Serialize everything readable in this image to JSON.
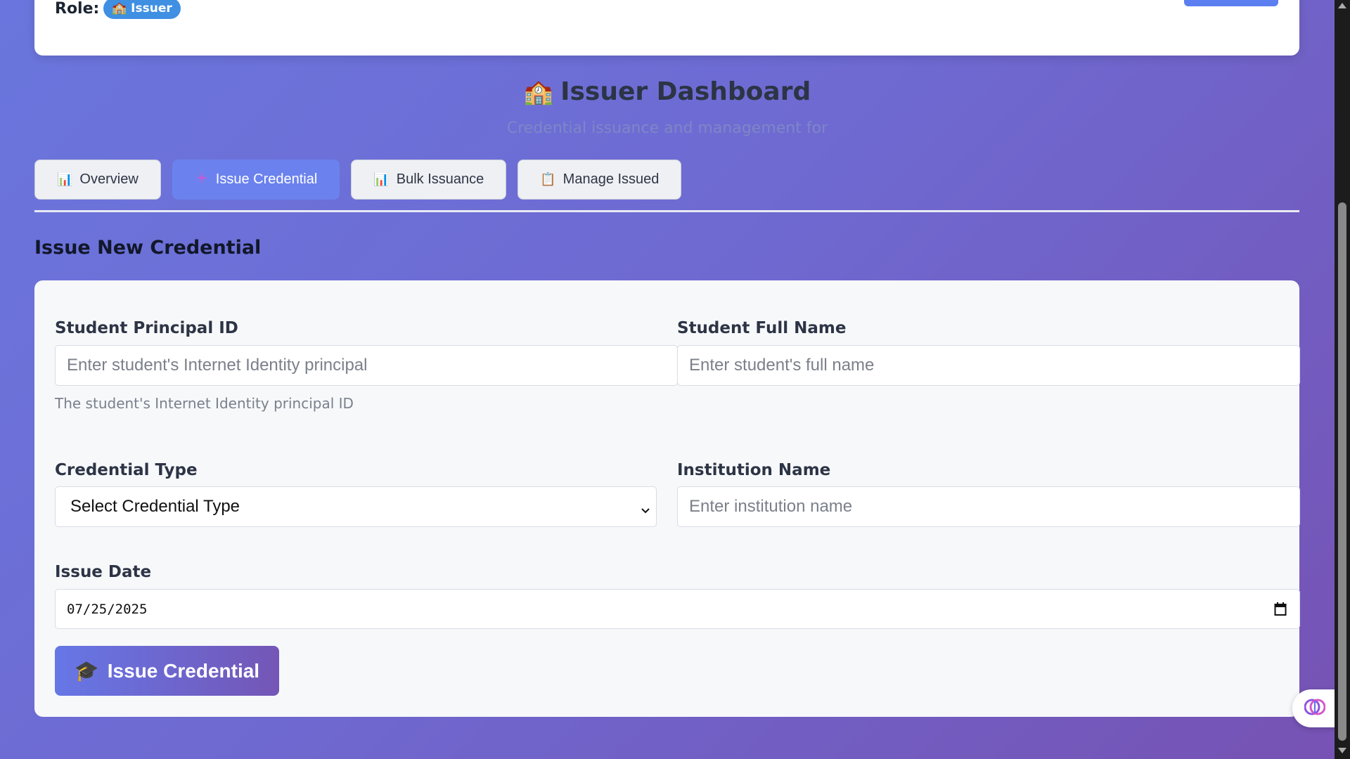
{
  "header": {
    "role_label": "Role:",
    "role_badge_icon": "🏫",
    "role_badge_text": "Issuer"
  },
  "dashboard": {
    "title_icon": "🏫",
    "title": "Issuer Dashboard",
    "subtitle": "Credential issuance and management for"
  },
  "tabs": [
    {
      "icon": "📊",
      "label": "Overview",
      "active": false
    },
    {
      "icon": "+",
      "label": "Issue Credential",
      "active": true
    },
    {
      "icon": "📊",
      "label": "Bulk Issuance",
      "active": false
    },
    {
      "icon": "📋",
      "label": "Manage Issued",
      "active": false
    }
  ],
  "section_title": "Issue New Credential",
  "form": {
    "student_principal": {
      "label": "Student Principal ID",
      "placeholder": "Enter student's Internet Identity principal",
      "hint": "The student's Internet Identity principal ID"
    },
    "student_name": {
      "label": "Student Full Name",
      "placeholder": "Enter student's full name"
    },
    "credential_type": {
      "label": "Credential Type",
      "selected": "Select Credential Type"
    },
    "institution": {
      "label": "Institution Name",
      "placeholder": "Enter institution name"
    },
    "issue_date": {
      "label": "Issue Date",
      "value": "07/25/2025"
    },
    "submit": {
      "icon": "🎓",
      "label": "Issue Credential"
    }
  },
  "colors": {
    "active_tab": "#6b82ee",
    "badge": "#3f8fe3",
    "button_start": "#6677e6",
    "button_end": "#7456b6"
  }
}
